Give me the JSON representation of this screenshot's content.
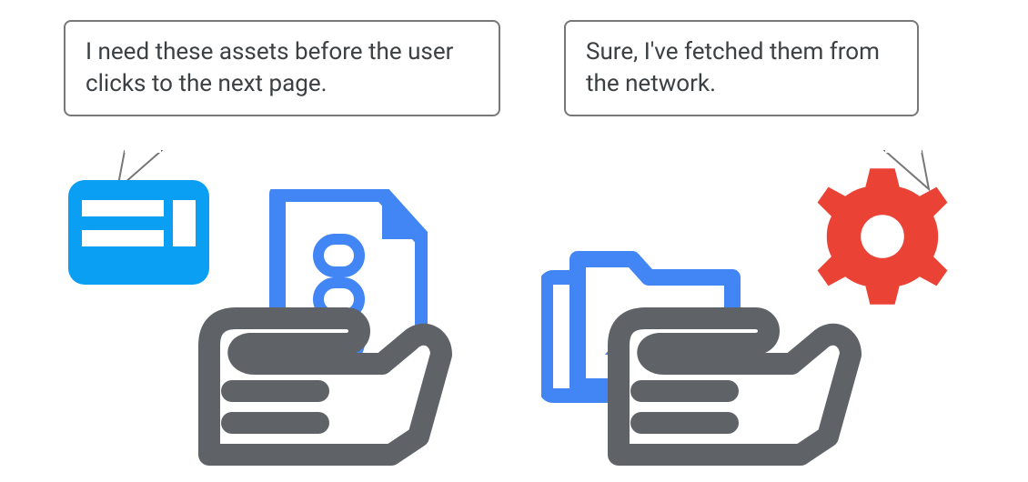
{
  "bubbles": {
    "left": "I need these assets before the user clicks to the next page.",
    "right": "Sure, I've fetched them from the network."
  },
  "icons": {
    "browser_window": "browser-window-icon",
    "hand_left": "hand-icon",
    "document_links": "document-with-links-icon",
    "folder_images": "image-folder-icon",
    "hand_right": "hand-icon",
    "gear": "gear-icon"
  },
  "colors": {
    "blue_light": "#0a9ff2",
    "blue_mid": "#4285f4",
    "gray": "#5f6368",
    "red": "#ea4335",
    "white": "#ffffff"
  }
}
